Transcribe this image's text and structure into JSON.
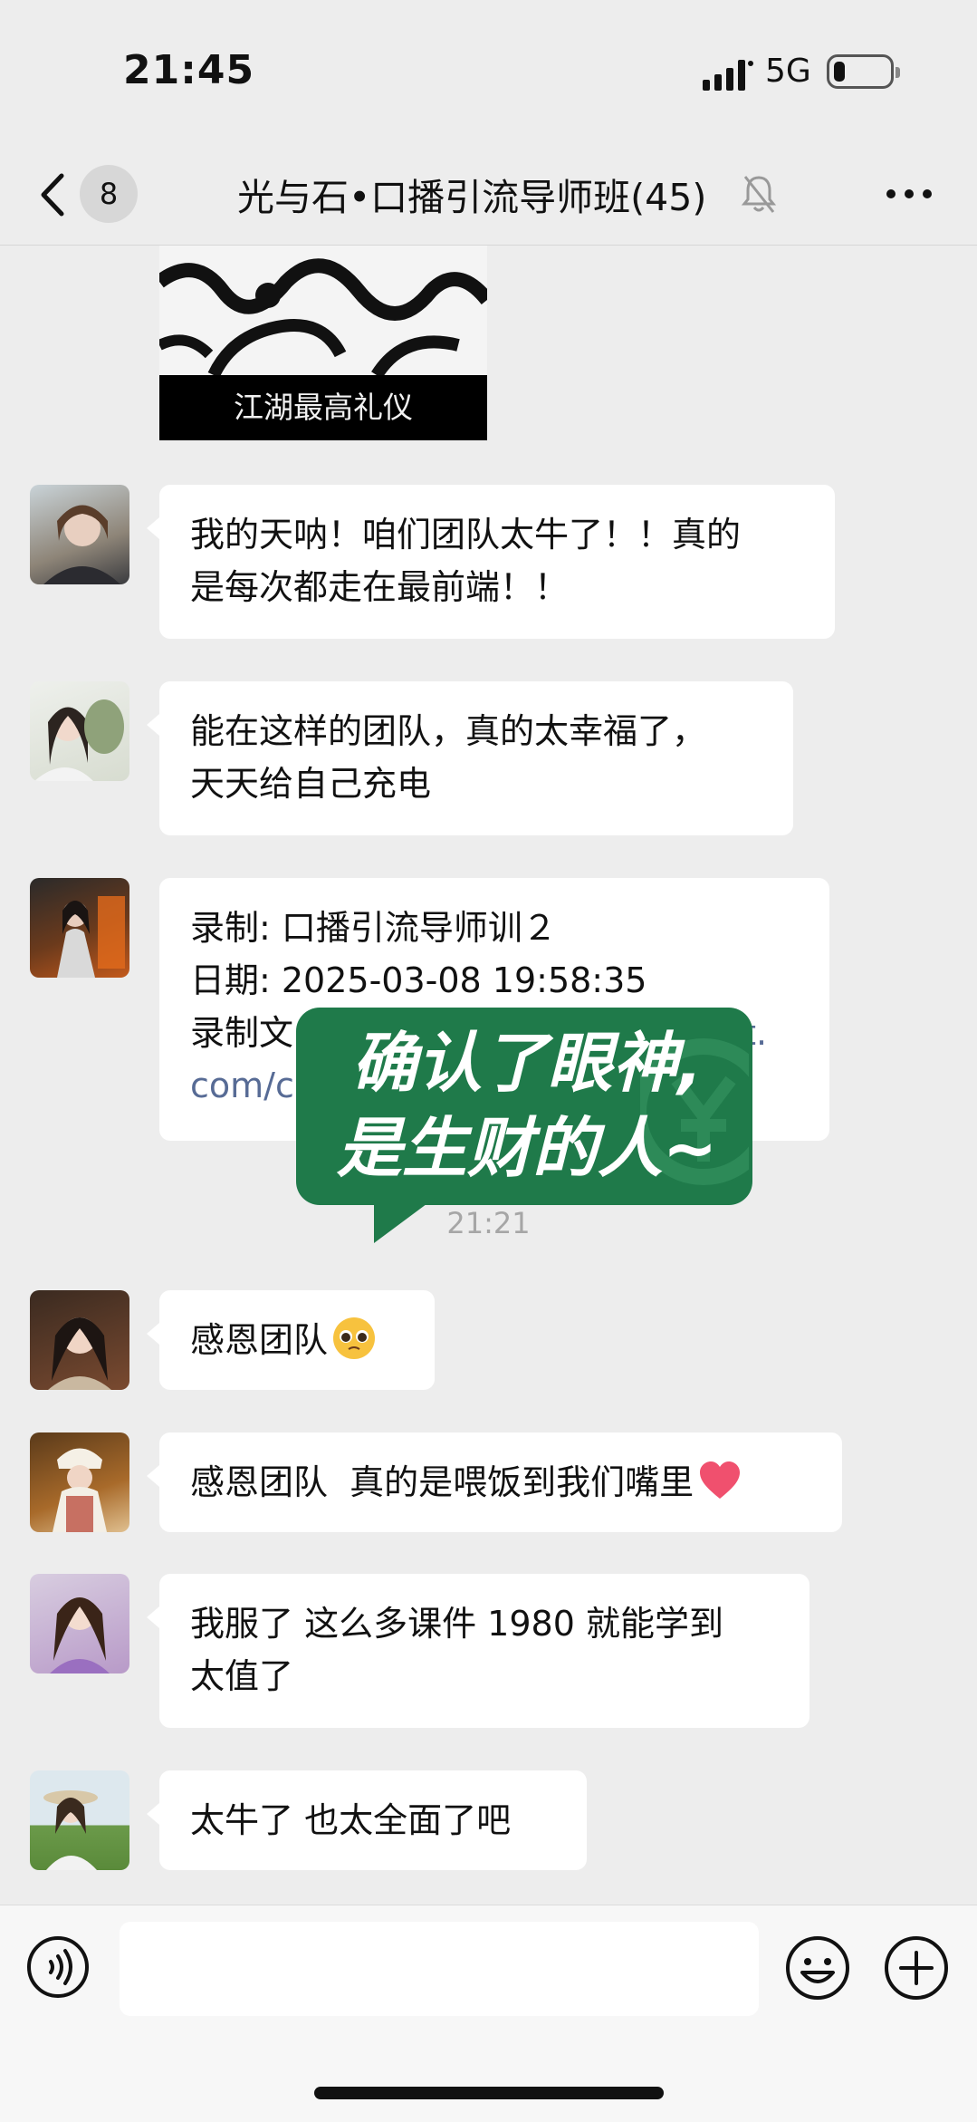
{
  "status_bar": {
    "time": "21:45",
    "network": "5G"
  },
  "header": {
    "unread_count": "8",
    "title": "光与石•口播引流导师班(45)"
  },
  "sticker": {
    "caption": "江湖最高礼仪"
  },
  "messages": [
    {
      "text": "我的天呐！咱们团队太牛了！！真的\n是每次都走在最前端！！"
    },
    {
      "text": "能在这样的团队，真的太幸福了，\n天天给自己充电"
    },
    {
      "line1": "录制: 口播引流导师训２",
      "line2": "日期: 2025-03-08 19:58:35",
      "line3_prefix": "录制文",
      "line3_link": "nt.",
      "line4_link": "com/c"
    },
    {
      "text": "感恩团队"
    },
    {
      "text": "感恩团队  真的是喂饭到我们嘴里"
    },
    {
      "text": "我服了 这么多课件 1980 就能学到\n太值了"
    },
    {
      "text": "太牛了 也太全面了吧"
    }
  ],
  "timestamp": "21:21",
  "overlay": {
    "line1": "确认了眼神,",
    "line2": "是生财的人~"
  },
  "colors": {
    "overlay_green": "#1f7a4a",
    "link_blue": "#576b95",
    "chat_bg": "#ededed"
  }
}
